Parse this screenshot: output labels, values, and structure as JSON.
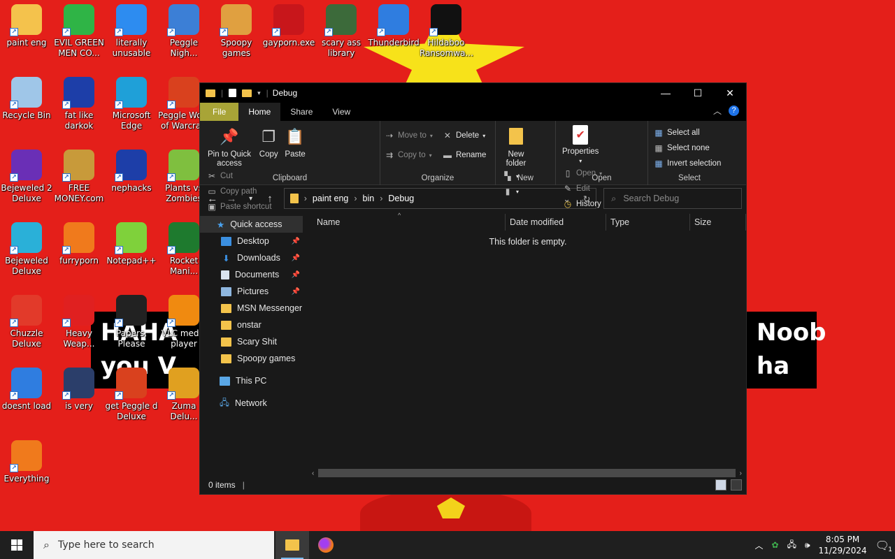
{
  "desktop": {
    "icons": [
      {
        "label": "paint eng",
        "icon": "folder-icon",
        "color": "#f4c24c"
      },
      {
        "label": "EVIL GREEN MEN CO...",
        "icon": "msn-icon",
        "color": "#2fb446"
      },
      {
        "label": "literally unusable",
        "icon": "chrome-icon",
        "color": "#2d8cf0"
      },
      {
        "label": "Peggle Nigh...",
        "icon": "peggle-icon",
        "color": "#3c7fd6"
      },
      {
        "label": "Spoopy games",
        "icon": "folder-icon",
        "color": "#e0a040"
      },
      {
        "label": "gayporn.exe",
        "icon": "flash-icon",
        "color": "#c8161b"
      },
      {
        "label": "scary ass library",
        "icon": "library-icon",
        "color": "#3c6a3a"
      },
      {
        "label": "Thunderbird",
        "icon": "thunderbird-icon",
        "color": "#2f7de0"
      },
      {
        "label": "Hildaboo Ransomwa...",
        "icon": "yashma-icon",
        "color": "#111111"
      },
      {
        "label": "Recycle Bin",
        "icon": "recycle-bin-icon",
        "color": "#9fc6e8"
      },
      {
        "label": "fat like darkok",
        "icon": "mpi-icon",
        "color": "#1d3ea8"
      },
      {
        "label": "Microsoft Edge",
        "icon": "edge-icon",
        "color": "#1fa0d8"
      },
      {
        "label": "Peggle Wo... of Warcraft",
        "icon": "peggle-icon",
        "color": "#d9411e"
      },
      {
        "label": "Bejeweled 2 Deluxe",
        "icon": "bejeweled-icon",
        "color": "#6a2fb6"
      },
      {
        "label": "FREE MONEY.com",
        "icon": "money-bag-icon",
        "color": "#c89a3a"
      },
      {
        "label": "nephacks",
        "icon": "mpi-icon",
        "color": "#1d3ea8"
      },
      {
        "label": "Plants vs Zombies",
        "icon": "pvz-icon",
        "color": "#7fbf3f"
      },
      {
        "label": "Bejeweled Deluxe",
        "icon": "gem-icon",
        "color": "#2ab0d8"
      },
      {
        "label": "furryporn",
        "icon": "firefox-icon",
        "color": "#f07a1c"
      },
      {
        "label": "Notepad++",
        "icon": "notepadpp-icon",
        "color": "#7fd13b"
      },
      {
        "label": "Rocket Mani...",
        "icon": "rocket-icon",
        "color": "#1e7a2e"
      },
      {
        "label": "Chuzzle Deluxe",
        "icon": "chuzzle-icon",
        "color": "#e23a2a"
      },
      {
        "label": "Heavy Weap...",
        "icon": "radiation-icon",
        "color": "#e02020"
      },
      {
        "label": "Papers, Please",
        "icon": "papers-icon",
        "color": "#222222"
      },
      {
        "label": "VLC media player",
        "icon": "vlc-icon",
        "color": "#f08a10"
      },
      {
        "label": "doesnt load",
        "icon": "thunderbird-icon",
        "color": "#2f7de0"
      },
      {
        "label": "is very",
        "icon": "mpi-icon",
        "color": "#2b3e6a"
      },
      {
        "label": "get Peggle d Deluxe",
        "icon": "peggle-icon",
        "color": "#d9411e"
      },
      {
        "label": "Zuma Delu...",
        "icon": "zuma-icon",
        "color": "#e0a020"
      },
      {
        "label": "Everything",
        "icon": "everything-icon",
        "color": "#f07a1c"
      }
    ],
    "banner_left": "HAHA you V",
    "banner_right": "Noob ha"
  },
  "explorer": {
    "title": "Debug",
    "window_buttons": {
      "minimize": "—",
      "maximize": "☐",
      "close": "✕"
    },
    "tabs": [
      "File",
      "Home",
      "Share",
      "View"
    ],
    "ribbon": {
      "clipboard": {
        "label": "Clipboard",
        "pin": "Pin to Quick access",
        "copy": "Copy",
        "paste": "Paste",
        "cut": "Cut",
        "copy_path": "Copy path",
        "paste_shortcut": "Paste shortcut"
      },
      "organize": {
        "label": "Organize",
        "move_to": "Move to",
        "copy_to": "Copy to",
        "delete": "Delete",
        "rename": "Rename"
      },
      "new": {
        "label": "New",
        "new_folder": "New folder"
      },
      "open": {
        "label": "Open",
        "properties": "Properties",
        "open": "Open",
        "edit": "Edit",
        "history": "History"
      },
      "select": {
        "label": "Select",
        "select_all": "Select all",
        "select_none": "Select none",
        "invert": "Invert selection"
      }
    },
    "address": {
      "parts": [
        "paint eng",
        "bin",
        "Debug"
      ]
    },
    "search_placeholder": "Search Debug",
    "nav": {
      "quick_access": "Quick access",
      "items": [
        "Desktop",
        "Downloads",
        "Documents",
        "Pictures",
        "MSN Messenger",
        "onstar",
        "Scary Shit",
        "Spoopy games"
      ],
      "this_pc": "This PC",
      "network": "Network"
    },
    "columns": [
      "Name",
      "Date modified",
      "Type",
      "Size"
    ],
    "empty_message": "This folder is empty.",
    "status": "0 items"
  },
  "taskbar": {
    "search_placeholder": "Type here to search",
    "time": "8:05 PM",
    "date": "11/29/2024",
    "notification_count": "1"
  }
}
